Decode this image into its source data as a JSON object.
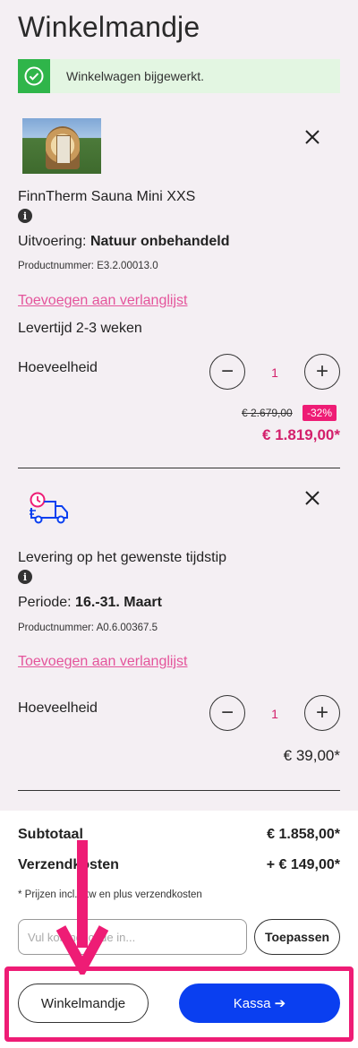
{
  "page": {
    "title": "Winkelmandje"
  },
  "toast": {
    "message": "Winkelwagen bijgewerkt.",
    "icon": "check-circle-icon",
    "color": "#2fb54a"
  },
  "items": [
    {
      "name": "FinnTherm Sauna Mini XXS",
      "variant_label": "Uitvoering:",
      "variant_value": "Natuur onbehandeld",
      "product_number": "Productnummer: E3.2.00013.0",
      "wishlist": "Toevoegen aan verlanglijst",
      "delivery": "Levertijd 2-3 weken",
      "quantity_label": "Hoeveelheid",
      "quantity": "1",
      "old_price": "€ 2.679,00",
      "discount": "-32%",
      "price": "€ 1.819,00*"
    },
    {
      "name": "Levering op het gewenste tijdstip",
      "variant_label": "Periode:",
      "variant_value": "16.-31. Maart",
      "product_number": "Productnummer: A0.6.00367.5",
      "wishlist": "Toevoegen aan verlanglijst",
      "quantity_label": "Hoeveelheid",
      "quantity": "1",
      "price": "€ 39,00*",
      "icon": "delivery-truck-clock-icon"
    }
  ],
  "summary": {
    "subtotal_label": "Subtotaal",
    "subtotal_value": "€ 1.858,00*",
    "shipping_label": "Verzendkosten",
    "shipping_value": "+ € 149,00*",
    "note": "* Prijzen incl. btw en plus verzendkosten",
    "coupon_placeholder": "Vul kortingscode in...",
    "apply_label": "Toepassen",
    "cart_button": "Winkelmandje",
    "checkout_button": "Kassa ➔"
  },
  "colors": {
    "accent": "#ee1c75",
    "primary": "#0a3ff0",
    "link": "#e4549b"
  }
}
